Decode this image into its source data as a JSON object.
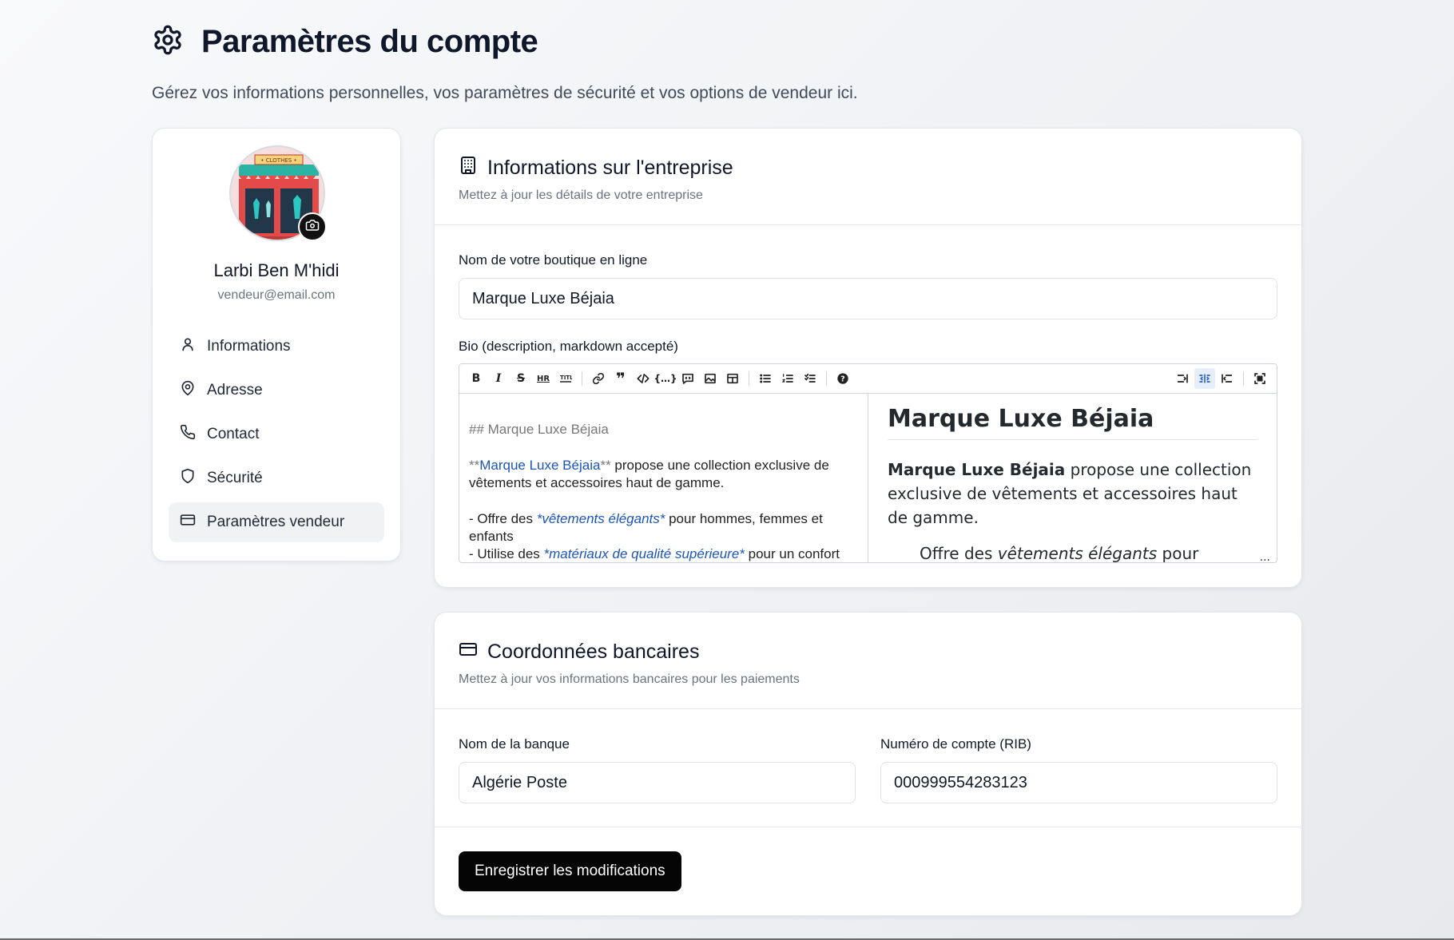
{
  "header": {
    "title": "Paramètres du compte",
    "subtitle": "Gérez vos informations personnelles, vos paramètres de sécurité et vos options de vendeur ici."
  },
  "profile": {
    "avatar_sign": "• CLOTHES •",
    "name": "Larbi Ben M'hidi",
    "email": "vendeur@email.com"
  },
  "sidebar": {
    "items": [
      {
        "label": "Informations",
        "icon": "user-icon"
      },
      {
        "label": "Adresse",
        "icon": "map-pin-icon"
      },
      {
        "label": "Contact",
        "icon": "phone-icon"
      },
      {
        "label": "Sécurité",
        "icon": "shield-icon"
      },
      {
        "label": "Paramètres vendeur",
        "icon": "credit-card-icon",
        "active": true
      }
    ]
  },
  "company": {
    "title": "Informations sur l'entreprise",
    "subtitle": "Mettez à jour les détails de votre entreprise",
    "shop_label": "Nom de votre boutique en ligne",
    "shop_value": "Marque Luxe Béjaia",
    "bio_label": "Bio (description, markdown accepté)"
  },
  "editor": {
    "toolbar": [
      "B",
      "I",
      "S",
      "HR",
      "title",
      "link",
      "quote",
      "code",
      "code-block",
      "comment",
      "image",
      "table",
      "ul",
      "ol",
      "task",
      "help"
    ],
    "md": {
      "heading": "## Marque Luxe Béjaia",
      "p_mark_open": "**",
      "p_strong": "Marque Luxe Béjaia",
      "p_mark_close": "**",
      "p_rest": " propose une collection exclusive de vêtements et accessoires haut de gamme.",
      "li1_prefix": "- Offre des ",
      "li1_em": "*vêtements élégants*",
      "li1_rest": " pour hommes, femmes et enfants",
      "li2_prefix": "- Utilise des ",
      "li2_em": "*matériaux de qualité supérieure*",
      "li2_rest": " pour un confort"
    },
    "preview": {
      "heading": "Marque Luxe Béjaia",
      "p_strong": "Marque Luxe Béjaia",
      "p_rest": " propose une collection exclusive de vêtements et accessoires haut de gamme.",
      "li1_prefix": "Offre des ",
      "li1_em": "vêtements élégants",
      "li1_rest": " pour hommes,",
      "ellipsis": "..."
    }
  },
  "bank": {
    "title": "Coordonnées bancaires",
    "subtitle": "Mettez à jour vos informations bancaires pour les paiements",
    "bank_label": "Nom de la banque",
    "bank_value": "Algérie Poste",
    "rib_label": "Numéro de compte (RIB)",
    "rib_value": "000999554283123",
    "save_label": "Enregistrer les modifications"
  }
}
